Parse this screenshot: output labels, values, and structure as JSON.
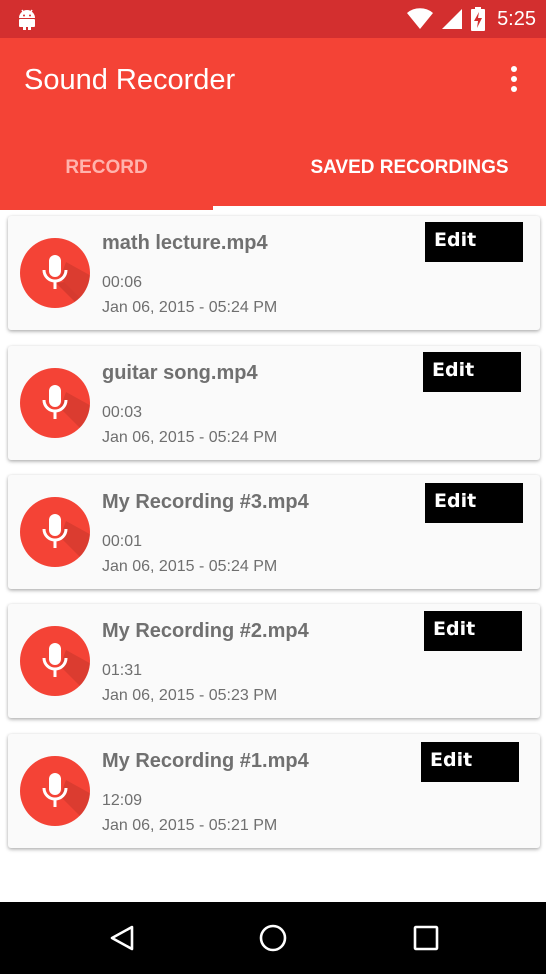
{
  "status_bar": {
    "time": "5:25",
    "icons": [
      "android-icon",
      "wifi-icon",
      "cell-signal-icon",
      "battery-charging-icon"
    ]
  },
  "app_bar": {
    "title": "Sound Recorder",
    "menu_icon": "overflow-menu-icon"
  },
  "tabs": [
    {
      "label": "RECORD",
      "selected": false
    },
    {
      "label": "SAVED RECORDINGS",
      "selected": true
    }
  ],
  "recordings": [
    {
      "name": "math lecture.mp4",
      "duration": "00:06",
      "date": "Jan 06, 2015 - 05:24 PM",
      "edit_label": "Edit"
    },
    {
      "name": "guitar song.mp4",
      "duration": "00:03",
      "date": "Jan 06, 2015 - 05:24 PM",
      "edit_label": "Edit"
    },
    {
      "name": "My Recording #3.mp4",
      "duration": "00:01",
      "date": "Jan 06, 2015 - 05:24 PM",
      "edit_label": "Edit"
    },
    {
      "name": "My Recording #2.mp4",
      "duration": "01:31",
      "date": "Jan 06, 2015 - 05:23 PM",
      "edit_label": "Edit"
    },
    {
      "name": "My Recording #1.mp4",
      "duration": "12:09",
      "date": "Jan 06, 2015 - 05:21 PM",
      "edit_label": "Edit"
    }
  ],
  "colors": {
    "status_bar": "#d32f2f",
    "primary": "#f44336",
    "tab_inactive": "#ffb3ad",
    "card_bg": "#fafafa",
    "text_secondary": "#6f6f6f"
  },
  "nav_bar": {
    "icons": [
      "back-icon",
      "home-icon",
      "recents-icon"
    ]
  }
}
